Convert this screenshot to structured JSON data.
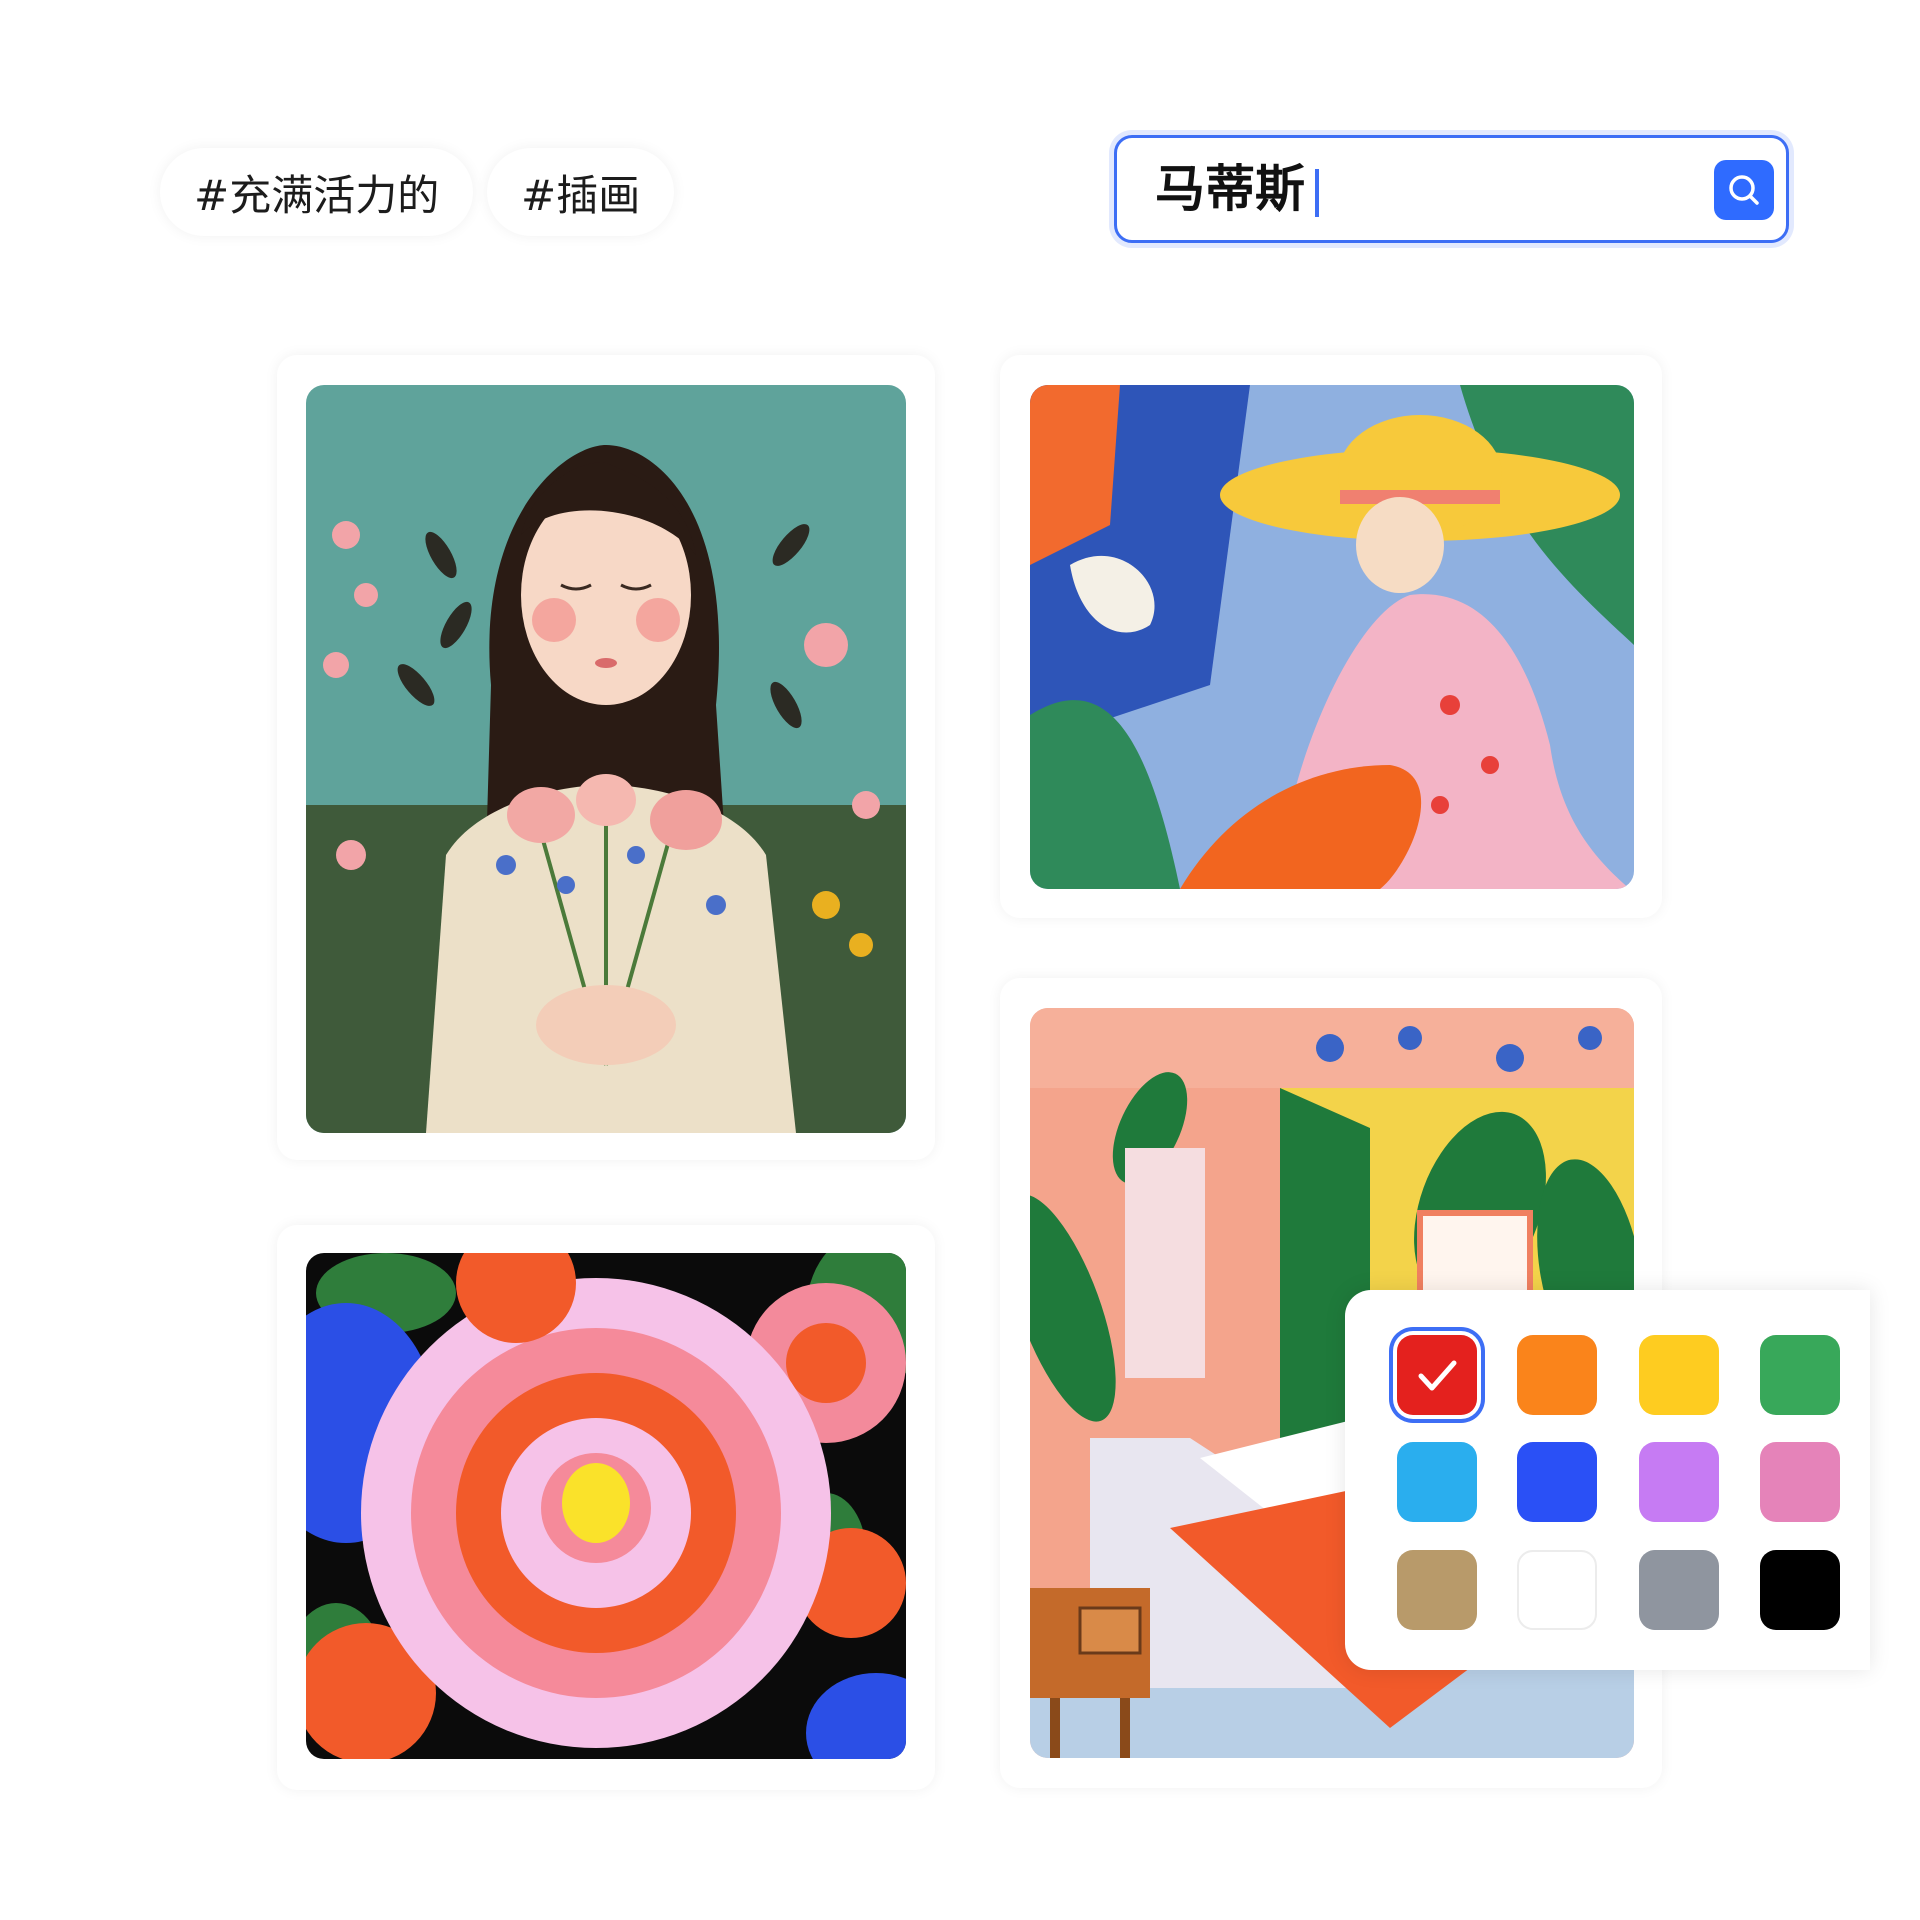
{
  "tags": [
    "#充满活力的",
    "#插画"
  ],
  "search": {
    "value": "马蒂斯"
  },
  "icons": {
    "search_button": "search-icon",
    "selected_swatch": "checkmark-icon"
  },
  "artworks": [
    {
      "subject": "girl-with-flowers"
    },
    {
      "subject": "woman-in-yellow-hat"
    },
    {
      "subject": "pink-flower-pattern"
    },
    {
      "subject": "colorful-bedroom"
    }
  ],
  "palette": {
    "colors": [
      "#e4211e",
      "#fa841b",
      "#fecc20",
      "#38a85a",
      "#2aaeee",
      "#2a50f6",
      "#c67bf3",
      "#e583b9",
      "#b89a6a",
      "#ffffff",
      "#8f959f",
      "#000000"
    ],
    "selected_index": 0
  }
}
